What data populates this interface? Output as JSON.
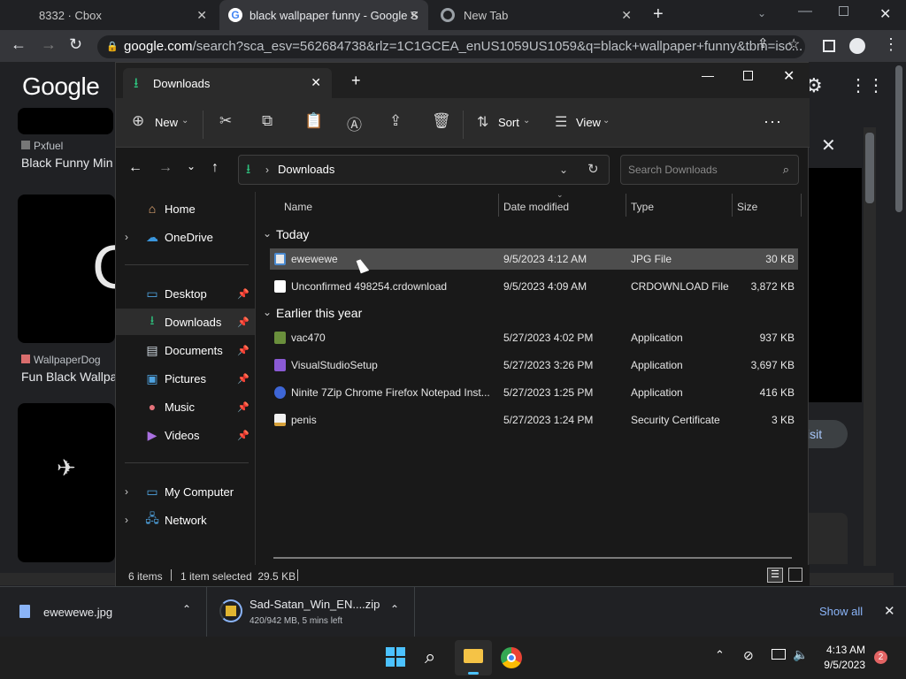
{
  "browser": {
    "tabs": [
      {
        "label": "8332 · Cbox"
      },
      {
        "label": "black wallpaper funny - Google S"
      },
      {
        "label": "New Tab"
      }
    ],
    "url_host": "google.com",
    "url_rest": "/search?sca_esv=562684738&rlz=1C1GCEA_enUS1059US1059&q=black+wallpaper+funny&tbm=isc..."
  },
  "google": {
    "logo": "Google",
    "results": [
      {
        "source": "Pxfuel",
        "title": "Black Funny Min"
      },
      {
        "source": "WallpaperDog",
        "title": "Fun Black Wallpa"
      }
    ],
    "visit_label": "isit"
  },
  "explorer": {
    "tab_title": "Downloads",
    "toolbar": {
      "new": "New",
      "sort": "Sort",
      "view": "View"
    },
    "address": "Downloads",
    "search_placeholder": "Search Downloads",
    "nav": {
      "home": "Home",
      "onedrive": "OneDrive",
      "desktop": "Desktop",
      "downloads": "Downloads",
      "documents": "Documents",
      "pictures": "Pictures",
      "music": "Music",
      "videos": "Videos",
      "mycomputer": "My Computer",
      "network": "Network"
    },
    "columns": {
      "name": "Name",
      "date": "Date modified",
      "type": "Type",
      "size": "Size"
    },
    "groups": {
      "today": "Today",
      "earlier": "Earlier this year"
    },
    "files": [
      {
        "name": "ewewewe",
        "date": "9/5/2023 4:12 AM",
        "type": "JPG File",
        "size": "30 KB"
      },
      {
        "name": "Unconfirmed 498254.crdownload",
        "date": "9/5/2023 4:09 AM",
        "type": "CRDOWNLOAD File",
        "size": "3,872 KB"
      },
      {
        "name": "vac470",
        "date": "5/27/2023 4:02 PM",
        "type": "Application",
        "size": "937 KB"
      },
      {
        "name": "VisualStudioSetup",
        "date": "5/27/2023 3:26 PM",
        "type": "Application",
        "size": "3,697 KB"
      },
      {
        "name": "Ninite 7Zip Chrome Firefox Notepad Inst...",
        "date": "5/27/2023 1:25 PM",
        "type": "Application",
        "size": "416 KB"
      },
      {
        "name": "penis",
        "date": "5/27/2023 1:24 PM",
        "type": "Security Certificate",
        "size": "3 KB"
      }
    ],
    "status": {
      "count": "6 items",
      "selected": "1 item selected  29.5 KB"
    }
  },
  "shelf": {
    "item1": "ewewewe.jpg",
    "item2_name": "Sad-Satan_Win_EN....zip",
    "item2_progress": "420/942 MB, 5 mins left",
    "show_all": "Show all"
  },
  "taskbar": {
    "time": "4:13 AM",
    "date": "9/5/2023",
    "badge": "2"
  }
}
